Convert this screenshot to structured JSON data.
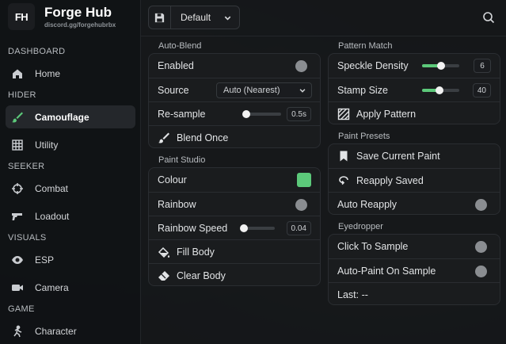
{
  "brand": {
    "logo": "FH",
    "title": "Forge Hub",
    "subtitle": "discord.gg/forgehubrbx"
  },
  "sidebar": {
    "sections": [
      {
        "label": "DASHBOARD"
      },
      {
        "label": "HIDER"
      },
      {
        "label": "SEEKER"
      },
      {
        "label": "VISUALS"
      },
      {
        "label": "GAME"
      }
    ],
    "items": [
      {
        "label": "Home",
        "icon": "home-icon"
      },
      {
        "label": "Camouflage",
        "icon": "brush-icon",
        "active": true
      },
      {
        "label": "Utility",
        "icon": "grid-icon"
      },
      {
        "label": "Combat",
        "icon": "crosshair-icon"
      },
      {
        "label": "Loadout",
        "icon": "gun-icon"
      },
      {
        "label": "ESP",
        "icon": "eye-icon"
      },
      {
        "label": "Camera",
        "icon": "camera-icon"
      },
      {
        "label": "Character",
        "icon": "person-icon"
      }
    ]
  },
  "topbar": {
    "preset": "Default",
    "save_icon": "floppy-icon",
    "search_icon": "search-icon"
  },
  "auto_blend": {
    "title": "Auto-Blend",
    "enabled_label": "Enabled",
    "source_label": "Source",
    "source_value": "Auto (Nearest)",
    "resample_label": "Re-sample",
    "resample_value": "0.5s",
    "resample_fraction": 0.08,
    "blend_once_label": "Blend Once"
  },
  "paint_studio": {
    "title": "Paint Studio",
    "colour_label": "Colour",
    "colour_value": "#5cc97a",
    "rainbow_label": "Rainbow",
    "rainbow_speed_label": "Rainbow Speed",
    "rainbow_speed_value": "0.04",
    "rainbow_speed_fraction": 0.02,
    "fill_body_label": "Fill Body",
    "clear_body_label": "Clear Body"
  },
  "pattern_match": {
    "title": "Pattern Match",
    "speckle_label": "Speckle Density",
    "speckle_value": "6",
    "speckle_fraction": 0.5,
    "stamp_label": "Stamp Size",
    "stamp_value": "40",
    "stamp_fraction": 0.47,
    "apply_label": "Apply Pattern"
  },
  "paint_presets": {
    "title": "Paint Presets",
    "save_label": "Save Current Paint",
    "reapply_label": "Reapply Saved",
    "auto_reapply_label": "Auto Reapply"
  },
  "eyedropper": {
    "title": "Eyedropper",
    "click_label": "Click To Sample",
    "auto_paint_label": "Auto-Paint On Sample",
    "last_label": "Last: --"
  },
  "colors": {
    "accent": "#5cc97a",
    "toggle_off": "#8a8d91"
  }
}
